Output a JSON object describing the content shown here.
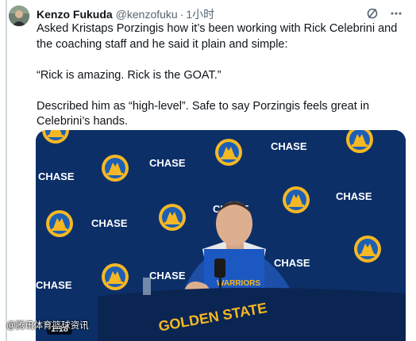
{
  "author": {
    "name": "Kenzo Fukuda",
    "handle": "@kenzofuku",
    "separator": "·",
    "time": "1小时"
  },
  "icons": {
    "grok": "grok-slash-icon",
    "more": "more-horizontal-icon"
  },
  "tweet": {
    "line1": "Asked Kristaps Porzingis how it’s been working with Rick Celebrini and the coaching staff and he said it plain and simple:",
    "line2": "“Rick is amazing. Rick is the GOAT.”",
    "line3": "Described him as “high-level”. Safe to say Porzingis feels great in Celebrini’s hands."
  },
  "video": {
    "duration": "1:18",
    "backdrop": {
      "sponsor": "CHASE",
      "team_top": "GOLDEN STATE",
      "team_bottom": "WARRIORS",
      "podium_text": "GOLDEN STATE"
    },
    "jersey_text": "WARRIORS"
  },
  "watermark": "@腾讯体育篮球资讯",
  "colors": {
    "backdrop": "#0c2f68",
    "warriors_gold": "#f5b824",
    "warriors_blue": "#1d5fb4"
  }
}
